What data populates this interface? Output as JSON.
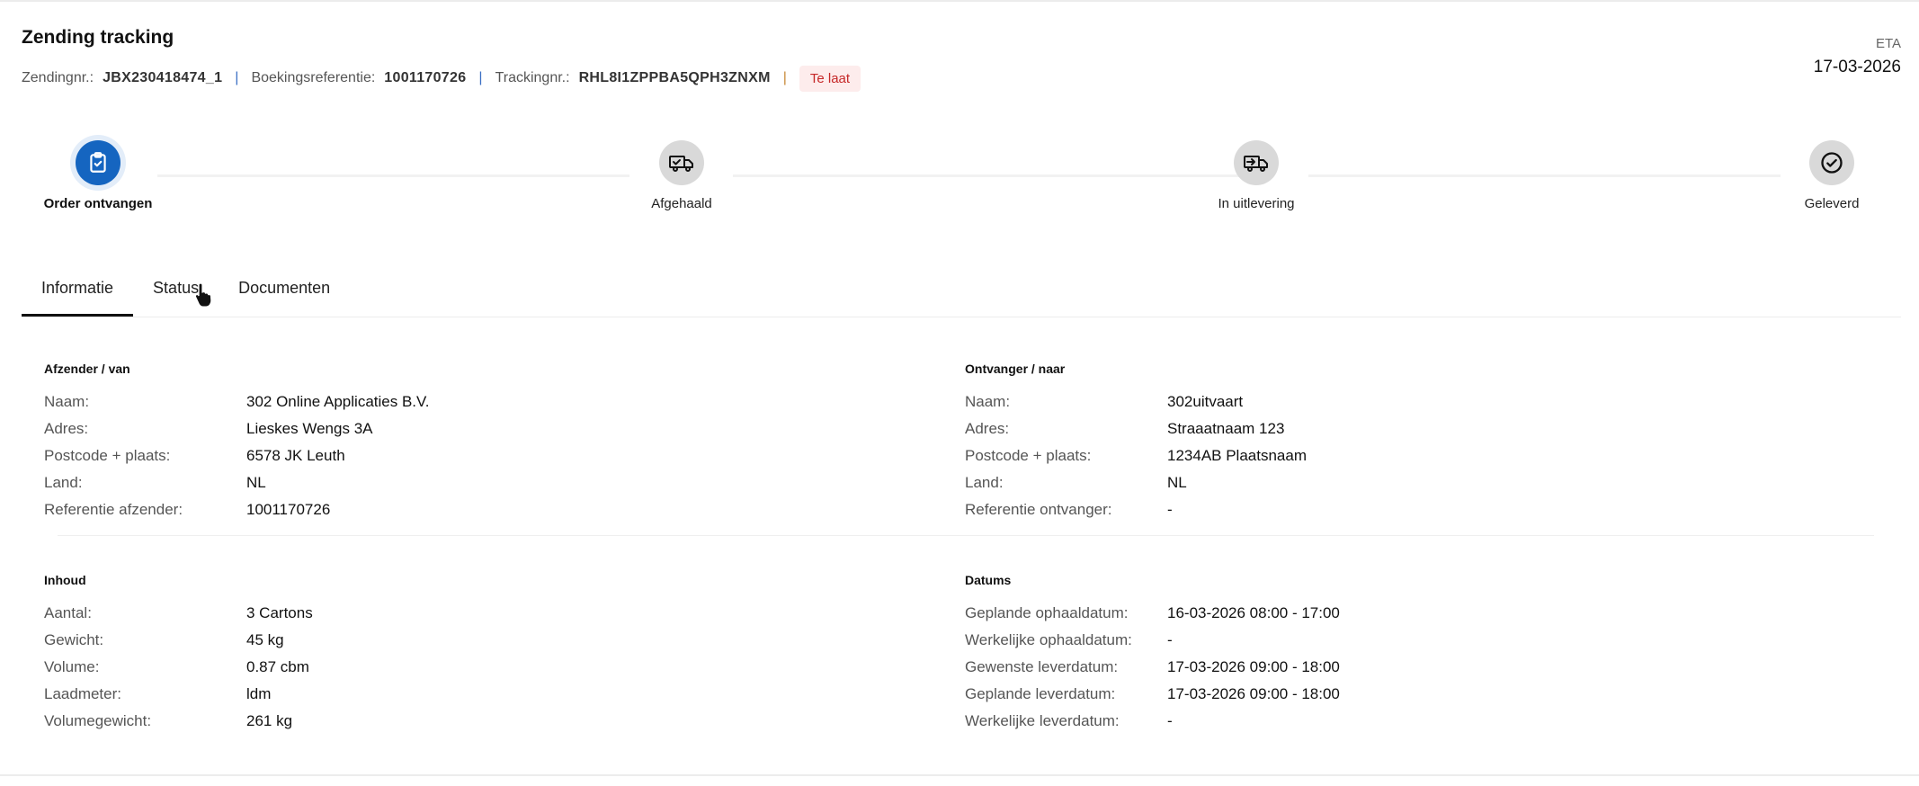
{
  "header": {
    "title": "Zending tracking",
    "shipment_label": "Zendingnr.:",
    "shipment_value": "JBX230418474_1",
    "booking_label": "Boekingsreferentie:",
    "booking_value": "1001170726",
    "tracking_label": "Trackingnr.:",
    "tracking_value": "RHL8I1ZPPBA5QPH3ZNXM",
    "status_badge": "Te laat",
    "eta_label": "ETA",
    "eta_value": "17-03-2026"
  },
  "progress": {
    "steps": [
      {
        "label": "Order ontvangen",
        "icon": "clipboard-check-icon",
        "active": true
      },
      {
        "label": "Afgehaald",
        "icon": "truck-check-icon",
        "active": false
      },
      {
        "label": "In uitlevering",
        "icon": "delivery-truck-icon",
        "active": false
      },
      {
        "label": "Geleverd",
        "icon": "check-circle-icon",
        "active": false
      }
    ]
  },
  "tabs": [
    {
      "label": "Informatie",
      "active": true
    },
    {
      "label": "Status",
      "active": false
    },
    {
      "label": "Documenten",
      "active": false
    }
  ],
  "sender": {
    "heading": "Afzender / van",
    "rows": [
      {
        "k": "Naam:",
        "v": "302 Online Applicaties B.V."
      },
      {
        "k": "Adres:",
        "v": "Lieskes Wengs 3A"
      },
      {
        "k": "Postcode + plaats:",
        "v": "6578 JK Leuth"
      },
      {
        "k": "Land:",
        "v": "NL"
      },
      {
        "k": "Referentie afzender:",
        "v": "1001170726"
      }
    ]
  },
  "receiver": {
    "heading": "Ontvanger / naar",
    "rows": [
      {
        "k": "Naam:",
        "v": "302uitvaart"
      },
      {
        "k": "Adres:",
        "v": "Straaatnaam 123"
      },
      {
        "k": "Postcode + plaats:",
        "v": "1234AB Plaatsnaam"
      },
      {
        "k": "Land:",
        "v": "NL"
      },
      {
        "k": "Referentie ontvanger:",
        "v": "-"
      }
    ]
  },
  "contents": {
    "heading": "Inhoud",
    "rows": [
      {
        "k": "Aantal:",
        "v": "3 Cartons"
      },
      {
        "k": "Gewicht:",
        "v": "45 kg"
      },
      {
        "k": "Volume:",
        "v": "0.87 cbm"
      },
      {
        "k": "Laadmeter:",
        "v": "ldm"
      },
      {
        "k": "Volumegewicht:",
        "v": "261 kg"
      }
    ]
  },
  "dates": {
    "heading": "Datums",
    "rows": [
      {
        "k": "Geplande ophaaldatum:",
        "v": "16-03-2026 08:00 - 17:00"
      },
      {
        "k": "Werkelijke ophaaldatum:",
        "v": "-"
      },
      {
        "k": "Gewenste leverdatum:",
        "v": "17-03-2026 09:00 - 18:00"
      },
      {
        "k": "Geplande leverdatum:",
        "v": "17-03-2026 09:00 - 18:00"
      },
      {
        "k": "Werkelijke leverdatum:",
        "v": "-"
      }
    ]
  },
  "colors": {
    "accent": "#1565c0",
    "late": "#c62828",
    "late_bg": "#fdecec"
  }
}
